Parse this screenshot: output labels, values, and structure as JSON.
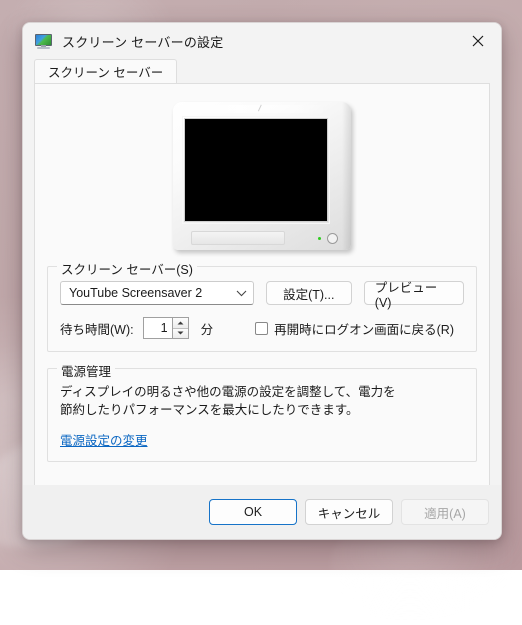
{
  "window": {
    "title": "スクリーン セーバーの設定",
    "icon": "monitor-icon",
    "close_label": "×"
  },
  "tabs": [
    {
      "label": "スクリーン セーバー",
      "selected": true
    }
  ],
  "preview": {
    "device": "crt-monitor-preview",
    "screen_state": "blank-black"
  },
  "screensaver_group": {
    "legend": "スクリーン セーバー(S)",
    "combo": {
      "value": "YouTube Screensaver 2",
      "options": [
        "YouTube Screensaver 2"
      ]
    },
    "settings_button": "設定(T)...",
    "preview_button": "プレビュー(V)",
    "wait_label": "待ち時間(W):",
    "wait_value": "1",
    "wait_unit": "分",
    "resume_checkbox_label": "再開時にログオン画面に戻る(R)",
    "resume_checkbox_checked": false
  },
  "power_group": {
    "legend": "電源管理",
    "description": "ディスプレイの明るさや他の電源の設定を調整して、電力を節約したりパフォーマンスを最大にしたりできます。",
    "link": "電源設定の変更",
    "link_color": "#0a66c2"
  },
  "footer": {
    "ok": "OK",
    "cancel": "キャンセル",
    "apply": "適用(A)",
    "apply_disabled": true,
    "accent_color": "#1673c8"
  }
}
